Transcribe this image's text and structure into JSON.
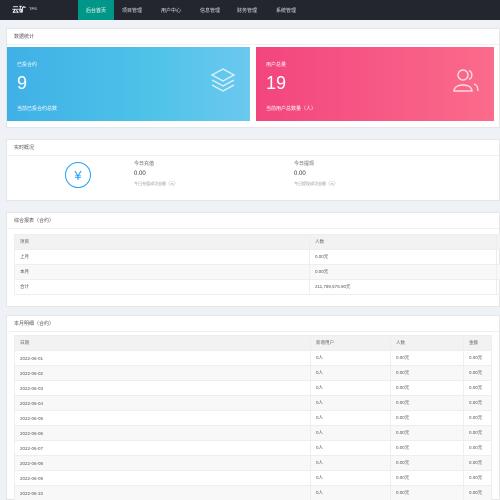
{
  "brand": {
    "name": "云矿",
    "sup": "TPS"
  },
  "nav": [
    {
      "label": "后台首页",
      "active": true
    },
    {
      "label": "项目管理"
    },
    {
      "label": "用户中心"
    },
    {
      "label": "信息管理"
    },
    {
      "label": "财务管理"
    },
    {
      "label": "系统管理"
    }
  ],
  "stats": {
    "title": "数据统计",
    "cards": [
      {
        "title": "已投合约",
        "value": "9",
        "sub": "当前已投合约总数",
        "icon": "layers-icon"
      },
      {
        "title": "用户总量",
        "value": "19",
        "sub": "当前用户总数量（人）",
        "icon": "users-icon"
      }
    ]
  },
  "realtime": {
    "title": "实时概况",
    "icon": "yen-icon",
    "items": [
      {
        "label": "今日充值",
        "value": "0.00",
        "note": "今日充值成功金额（元）"
      },
      {
        "label": "今日提现",
        "value": "0.00",
        "note": "今日提现成功金额（元）"
      }
    ]
  },
  "summary": {
    "title": "综合报表（合约）",
    "headers": [
      "项目",
      "人数",
      ""
    ],
    "rows": [
      [
        "上月",
        "0.00元",
        ""
      ],
      [
        "本月",
        "0.00元",
        ""
      ],
      [
        "合计",
        "211,789,576.90元",
        ""
      ]
    ]
  },
  "detail": {
    "title": "本月明细（合约）",
    "headers": [
      "日期",
      "新增用户",
      "人数",
      "金额"
    ],
    "rows": [
      [
        "2022-06-01",
        "0人",
        "0.00元",
        "0.00元"
      ],
      [
        "2022-06-02",
        "0人",
        "0.00元",
        "0.00元"
      ],
      [
        "2022-06-03",
        "0人",
        "0.00元",
        "0.00元"
      ],
      [
        "2022-06-04",
        "0人",
        "0.00元",
        "0.00元"
      ],
      [
        "2022-06-05",
        "0人",
        "0.00元",
        "0.00元"
      ],
      [
        "2022-06-06",
        "0人",
        "0.00元",
        "0.00元"
      ],
      [
        "2022-06-07",
        "0人",
        "0.00元",
        "0.00元"
      ],
      [
        "2022-06-08",
        "0人",
        "0.00元",
        "0.00元"
      ],
      [
        "2022-06-09",
        "0人",
        "0.00元",
        "0.00元"
      ],
      [
        "2022-06-10",
        "0人",
        "0.00元",
        "0.00元"
      ]
    ]
  },
  "colors": {
    "nav_bg": "#23262e",
    "nav_active": "#009688",
    "card_blue": "#3fb0e6",
    "card_pink": "#f2457e",
    "accent_icon": "#1e9fff"
  }
}
